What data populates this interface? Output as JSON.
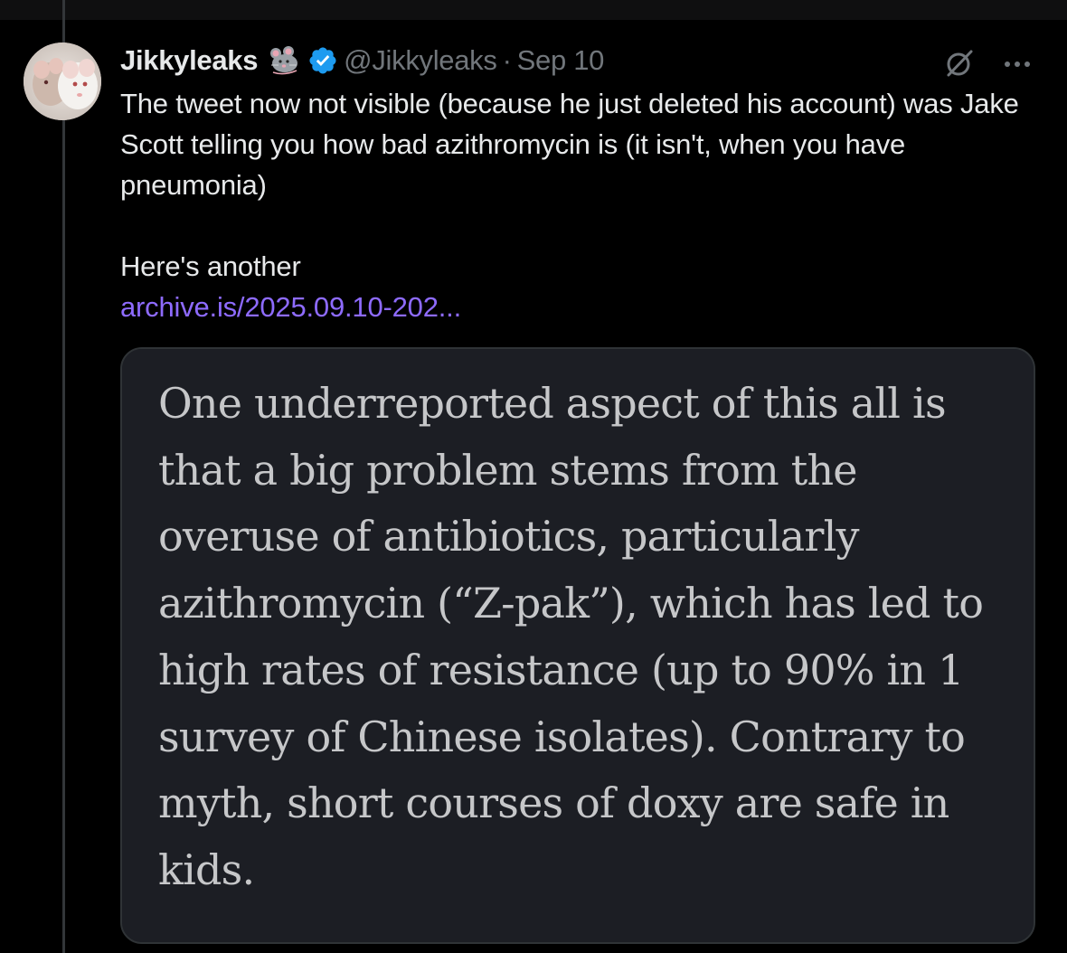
{
  "tweet": {
    "author": {
      "display_name": "Jikkyleaks",
      "emoji": "mouse-emoji",
      "verified": true,
      "handle": "@Jikkyleaks",
      "separator": "·",
      "date": "Sep 10"
    },
    "body": {
      "paragraph_1": "The tweet now not visible (because he just deleted his account) was Jake Scott telling you how bad azithromycin is (it isn't, when you have pneumonia)",
      "paragraph_2": "Here's another",
      "link": "archive.is/2025.09.10-202..."
    },
    "media": {
      "quote_text": "One underreported aspect of this all is that a big problem stems from the overuse of antibiotics, particularly azithromycin (“Z-pak”), which has led to high rates of resistance (up to 90% in 1 survey of Chinese isolates). Contrary to myth, short courses of doxy are safe in kids."
    },
    "icons": {
      "grok": "grok-icon",
      "more": "more-options-icon"
    },
    "colors": {
      "background": "#000000",
      "text": "#e7e9ea",
      "secondary": "#71767b",
      "link": "#8e6bff",
      "verified": "#1d9bf0",
      "media_bg": "#1c1e24"
    }
  }
}
